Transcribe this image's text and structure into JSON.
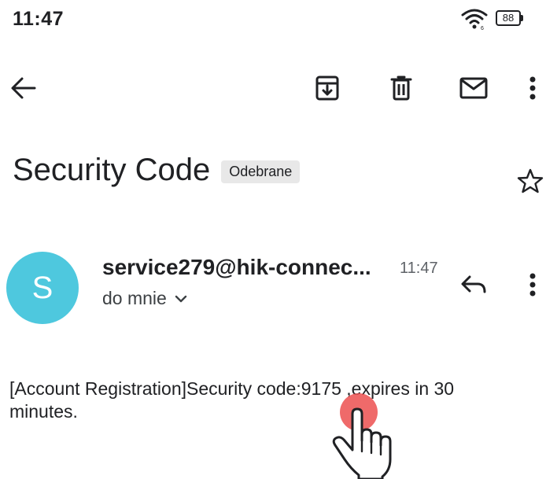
{
  "status_bar": {
    "time": "11:47",
    "battery": "88"
  },
  "toolbar": {
    "icons": [
      "back-arrow-icon",
      "archive-icon",
      "delete-icon",
      "mark-unread-icon",
      "more-vert-icon"
    ]
  },
  "email": {
    "subject": "Security Code",
    "label": "Odebrane",
    "avatar_letter": "S",
    "avatar_color": "#4ec8de",
    "sender": "service279@hik-connec...",
    "time": "11:47",
    "recipient": "do mnie",
    "body_line1": "[Account Registration]Security code:9175 ,expires in 30",
    "body_line2": "minutes."
  },
  "tap_indicator_color": "#ec5050"
}
